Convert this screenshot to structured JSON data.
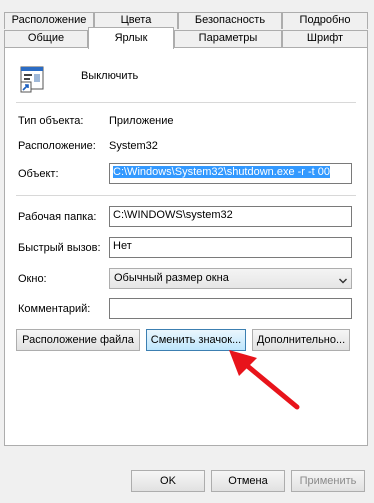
{
  "tabs_row1": [
    "Расположение",
    "Цвета",
    "Безопасность",
    "Подробно"
  ],
  "tabs_row2": [
    "Общие",
    "Ярлык",
    "Параметры",
    "Шрифт"
  ],
  "active_tab": "Ярлык",
  "shortcut_name": "Выключить",
  "info": {
    "type_label": "Тип объекта:",
    "type_value": "Приложение",
    "location_label": "Расположение:",
    "location_value": "System32",
    "target_label": "Объект:",
    "target_value": "C:\\Windows\\System32\\shutdown.exe -r -t 00"
  },
  "fields": {
    "workdir_label": "Рабочая папка:",
    "workdir_value": "C:\\WINDOWS\\system32",
    "hotkey_label": "Быстрый вызов:",
    "hotkey_value": "Нет",
    "window_label": "Окно:",
    "window_value": "Обычный размер окна",
    "comment_label": "Комментарий:",
    "comment_value": ""
  },
  "buttons": {
    "open_location": "Расположение файла",
    "change_icon": "Сменить значок...",
    "advanced": "Дополнительно...",
    "ok": "OK",
    "cancel": "Отмена",
    "apply": "Применить"
  },
  "colors": {
    "selection": "#3399ff",
    "arrow": "#e8141b",
    "focus_border": "#3c7fb1"
  }
}
